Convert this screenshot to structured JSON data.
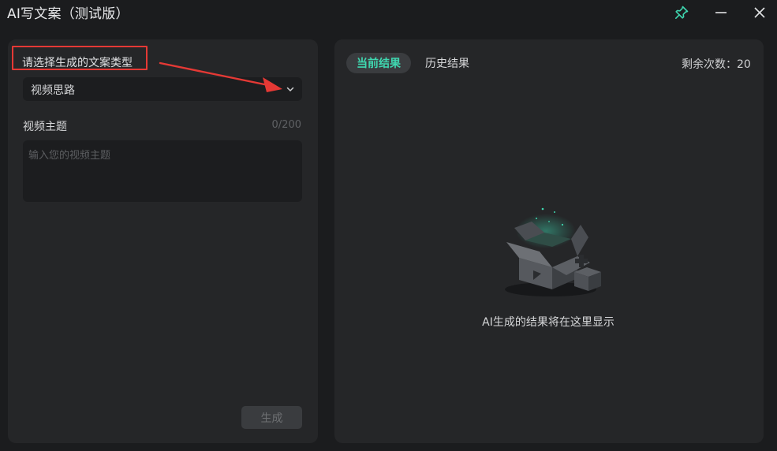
{
  "window": {
    "title": "AI写文案（测试版）",
    "pin_icon": "pin-icon",
    "minimize_icon": "minimize-icon",
    "close_icon": "close-icon",
    "accent_color": "#3fd7b0"
  },
  "left": {
    "type_label": "请选择生成的文案类型",
    "type_select": {
      "value": "视频思路",
      "icon": "chevron-down-icon"
    },
    "topic": {
      "label": "视频主题",
      "counter": "0/200",
      "placeholder": "输入您的视频主题",
      "value": ""
    },
    "generate_label": "生成"
  },
  "right": {
    "tabs": [
      {
        "label": "当前结果",
        "active": true
      },
      {
        "label": "历史结果",
        "active": false
      }
    ],
    "remaining": "剩余次数：20",
    "empty_icon": "empty-box-icon",
    "empty_text": "AI生成的结果将在这里显示"
  },
  "annotation": {
    "highlight_color": "#e53935"
  }
}
